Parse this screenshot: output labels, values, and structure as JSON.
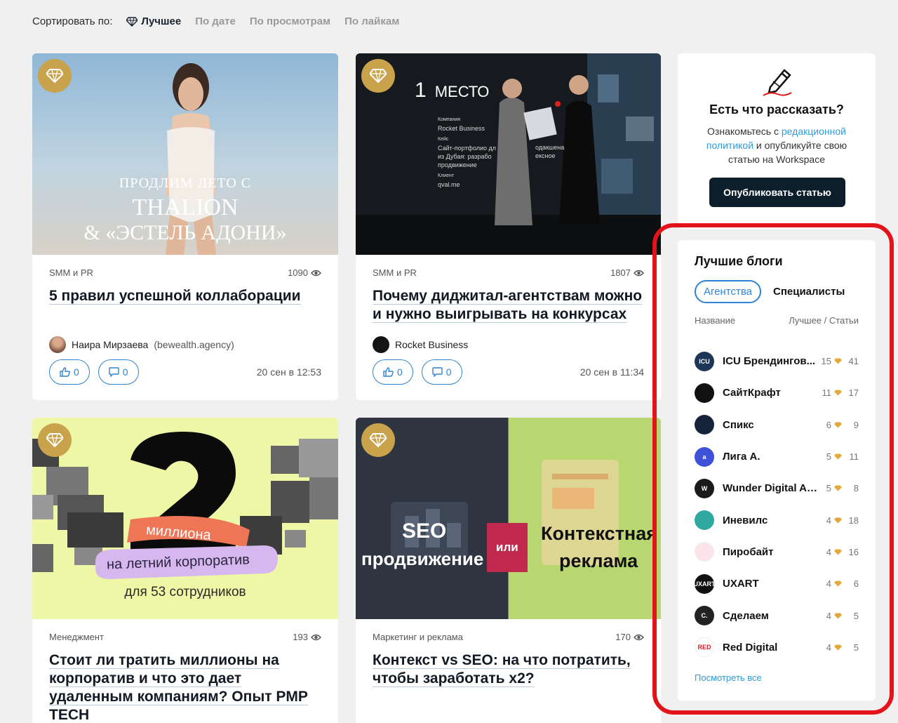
{
  "sort": {
    "label": "Сортировать по:",
    "options": [
      "Лучшее",
      "По дате",
      "По просмотрам",
      "По лайкам"
    ],
    "active": 0
  },
  "cards": [
    {
      "image_text": [
        "ПРОДЛИМ ЛЕТО С",
        "THALION",
        "& «ЭСТЕЛЬ АДОНИ»"
      ],
      "category": "SMM и PR",
      "views": "1090",
      "title": "5 правил успешной коллаборации",
      "author": "Наира Мирзаева",
      "author_sub": "(bewealth.agency)",
      "likes": "0",
      "comments": "0",
      "date": "20 сен в 12:53"
    },
    {
      "image_text": [
        "1",
        "МЕСТО",
        "Компания",
        "Rocket Business",
        "Кейс",
        "Сайт-портфолио дл",
        "из Дубая: разрабо",
        "продвижение",
        "Клиент",
        "qval.me",
        "одакшена",
        "ексное"
      ],
      "category": "SMM и PR",
      "views": "1807",
      "title": "Почему диджитал-агентствам можно и нужно выигрывать на конкурсах",
      "author": "Rocket Business",
      "author_sub": "",
      "likes": "0",
      "comments": "0",
      "date": "20 сен в 11:34"
    },
    {
      "image_text": [
        "2",
        "миллиона",
        "на летний корпоратив",
        "для 53 сотрудников"
      ],
      "category": "Менеджмент",
      "views": "193",
      "title": "Стоит ли тратить миллионы на корпоратив и что это дает удаленным компаниям? Опыт PMP TECH"
    },
    {
      "image_text": [
        "SEO",
        "продвижение",
        "или",
        "Контекстная",
        "реклама"
      ],
      "category": "Маркетинг и реклама",
      "views": "170",
      "title": "Контекст vs SEO: на что потратить, чтобы заработать x2?"
    }
  ],
  "promo": {
    "title": "Есть что рассказать?",
    "text_before": "Ознакомьтесь с ",
    "link": "редакционной политикой",
    "text_after": " и опубликуйте свою статью на Workspace",
    "button": "Опубликовать статью"
  },
  "blogs": {
    "title": "Лучшие блоги",
    "tabs": [
      "Агентства",
      "Специалисты"
    ],
    "col_name": "Название",
    "col_stats": "Лучшее / Статьи",
    "rows": [
      {
        "name": "ICU Брендингов...",
        "best": "15",
        "articles": "41",
        "logo_text": "ICU",
        "color": "#1d3557"
      },
      {
        "name": "СайтКрафт",
        "best": "11",
        "articles": "17",
        "logo_text": "",
        "color": "#111111"
      },
      {
        "name": "Спикс",
        "best": "6",
        "articles": "9",
        "logo_text": "",
        "color": "#14233a"
      },
      {
        "name": "Лига А.",
        "best": "5",
        "articles": "11",
        "logo_text": "a",
        "color": "#3f51d8"
      },
      {
        "name": "Wunder Digital Ag...",
        "best": "5",
        "articles": "8",
        "logo_text": "W",
        "color": "#1a1a1a"
      },
      {
        "name": "Иневилс",
        "best": "4",
        "articles": "18",
        "logo_text": "",
        "color": "#2fa8a0"
      },
      {
        "name": "Пиробайт",
        "best": "4",
        "articles": "16",
        "logo_text": "",
        "color": "#fde3ea"
      },
      {
        "name": "UXART",
        "best": "4",
        "articles": "6",
        "logo_text": "UXART",
        "color": "#111111"
      },
      {
        "name": "Сделаем",
        "best": "4",
        "articles": "5",
        "logo_text": "C.",
        "color": "#222222"
      },
      {
        "name": "Red Digital",
        "best": "4",
        "articles": "5",
        "logo_text": "RED",
        "color": "#ffffff"
      }
    ],
    "see_all": "Посмотреть все"
  }
}
